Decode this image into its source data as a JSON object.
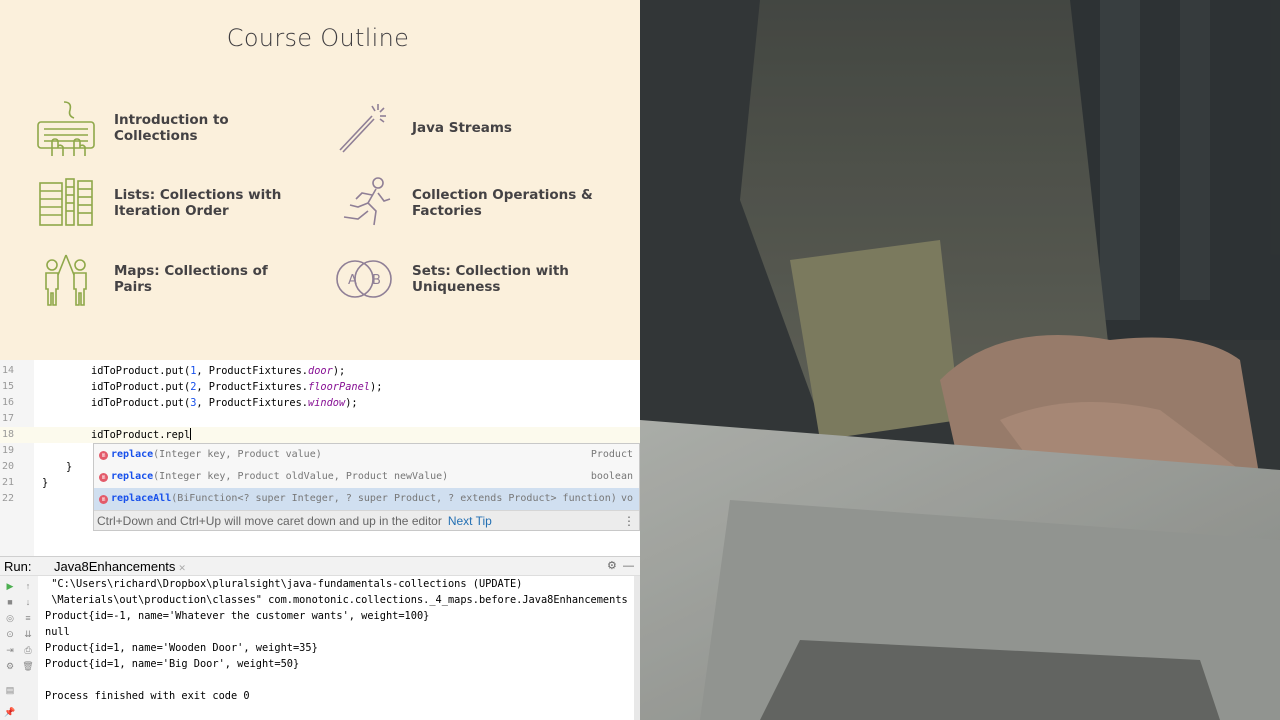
{
  "slide": {
    "title": "Course Outline",
    "topics": [
      {
        "label": "Introduction to\nCollections",
        "icon": "keyboard-hands-icon"
      },
      {
        "label": "Java Streams",
        "icon": "magic-wand-icon"
      },
      {
        "label": "Lists: Collections with\nIteration Order",
        "icon": "table-list-icon"
      },
      {
        "label": "Collection Operations &\nFactories",
        "icon": "running-person-icon"
      },
      {
        "label": "Maps: Collections of Pairs",
        "icon": "high-five-people-icon"
      },
      {
        "label": "Sets: Collection with\nUniqueness",
        "icon": "venn-diagram-icon"
      }
    ],
    "venn_a": "A",
    "venn_b": "B",
    "accent": "#8fa84a"
  },
  "editor": {
    "lines": [
      {
        "num": "14",
        "pre": "idToProduct.put(",
        "arg": "1",
        "mid": ", ProductFixtures.",
        "field": "door",
        "post": ");"
      },
      {
        "num": "15",
        "pre": "idToProduct.put(",
        "arg": "2",
        "mid": ", ProductFixtures.",
        "field": "floorPanel",
        "post": ");"
      },
      {
        "num": "16",
        "pre": "idToProduct.put(",
        "arg": "3",
        "mid": ", ProductFixtures.",
        "field": "window",
        "post": ");"
      },
      {
        "num": "17",
        "text": ""
      },
      {
        "num": "18",
        "text": "idToProduct.repl"
      },
      {
        "num": "19",
        "text": ""
      },
      {
        "num": "20",
        "text": "}"
      },
      {
        "num": "21",
        "text": "}"
      },
      {
        "num": "22",
        "text": ""
      }
    ],
    "completion": {
      "items": [
        {
          "match": "repl",
          "rest": "ace",
          "sig": "(Integer key, Product value)",
          "ret": "Product"
        },
        {
          "match": "repl",
          "rest": "ace",
          "sig": "(Integer key, Product oldValue, Product newValue)",
          "ret": "boolean"
        },
        {
          "match": "repl",
          "rest": "aceAll",
          "sig": "(BiFunction<? super Integer, ? super Product, ? extends Product> function)",
          "ret": "vo"
        }
      ],
      "tip": "Ctrl+Down and Ctrl+Up will move caret down and up in the editor",
      "tip_link": "Next Tip"
    }
  },
  "run": {
    "label": "Run:",
    "tab": "Java8Enhancements",
    "console": [
      " \"C:\\Users\\richard\\Dropbox\\pluralsight\\java-fundamentals-collections (UPDATE)",
      " \\Materials\\out\\production\\classes\" com.monotonic.collections._4_maps.before.Java8Enhancements",
      "Product{id=-1, name='Whatever the customer wants', weight=100}",
      "null",
      "Product{id=1, name='Wooden Door', weight=35}",
      "Product{id=1, name='Big Door', weight=50}",
      "",
      "Process finished with exit code 0"
    ]
  }
}
